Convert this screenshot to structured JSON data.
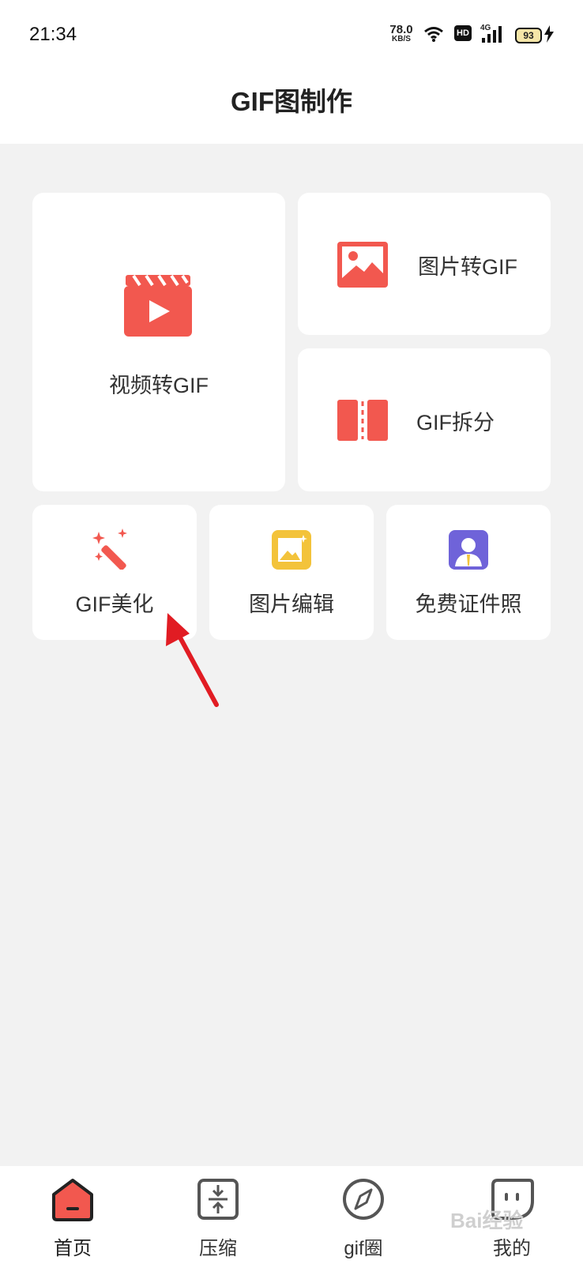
{
  "status_bar": {
    "time": "21:34",
    "net_speed_value": "78.0",
    "net_speed_unit": "KB/S",
    "hd_badge": "HD",
    "signal_label": "4G",
    "battery_level": "93",
    "icons": [
      "wifi-icon",
      "hd-icon",
      "signal-icon",
      "battery-icon",
      "charging-icon"
    ]
  },
  "header": {
    "title": "GIF图制作"
  },
  "features": {
    "video_to_gif": {
      "label": "视频转GIF",
      "icon": "video-clapper-icon"
    },
    "image_to_gif": {
      "label": "图片转GIF",
      "icon": "image-icon"
    },
    "gif_split": {
      "label": "GIF拆分",
      "icon": "split-icon"
    },
    "gif_beautify": {
      "label": "GIF美化",
      "icon": "magic-wand-icon"
    },
    "image_edit": {
      "label": "图片编辑",
      "icon": "image-edit-icon"
    },
    "id_photo": {
      "label": "免费证件照",
      "icon": "id-photo-icon"
    }
  },
  "annotation": {
    "icon": "red-arrow-icon"
  },
  "tabbar": {
    "items": [
      {
        "label": "首页",
        "icon": "home-icon",
        "active": true
      },
      {
        "label": "压缩",
        "icon": "compress-icon",
        "active": false
      },
      {
        "label": "gif圈",
        "icon": "compass-icon",
        "active": false
      },
      {
        "label": "我的",
        "icon": "profile-icon",
        "active": false
      }
    ]
  },
  "watermark": {
    "text": "Bai经验"
  },
  "colors": {
    "accent": "#f2584f",
    "background": "#f2f2f2",
    "card": "#ffffff",
    "yellow": "#f3c33b",
    "purple": "#6f63d9"
  }
}
